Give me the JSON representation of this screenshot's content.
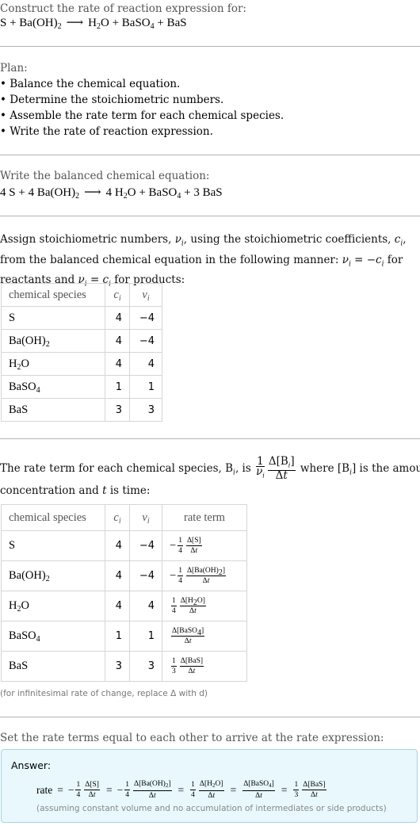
{
  "intro": {
    "label": "Construct the rate of reaction expression for:",
    "reaction": {
      "reactants": [
        "S",
        "Ba(OH)2"
      ],
      "products": [
        "H2O",
        "BaSO4",
        "BaS"
      ]
    }
  },
  "plan": {
    "label": "Plan:",
    "steps": [
      "Balance the chemical equation.",
      "Determine the stoichiometric numbers.",
      "Assemble the rate term for each chemical species.",
      "Write the rate of reaction expression."
    ]
  },
  "balanced": {
    "label": "Write the balanced chemical equation:",
    "coefficients": {
      "S": "4",
      "Ba(OH)2": "4",
      "H2O": "4",
      "BaSO4": "",
      "BaS": "3"
    }
  },
  "stoich": {
    "text_part1": "Assign stoichiometric numbers, ",
    "text_part2": ", using the stoichiometric coefficients, ",
    "text_part3": ", from the balanced chemical equation in the following manner: ",
    "text_part4": " for reactants and ",
    "text_part5": " for products:",
    "headers": [
      "chemical species",
      "c",
      "ν"
    ],
    "rows": [
      {
        "species": "S",
        "c": "4",
        "v": "−4"
      },
      {
        "species": "Ba(OH)2",
        "c": "4",
        "v": "−4"
      },
      {
        "species": "H2O",
        "c": "4",
        "v": "4"
      },
      {
        "species": "BaSO4",
        "c": "1",
        "v": "1"
      },
      {
        "species": "BaS",
        "c": "3",
        "v": "3"
      }
    ]
  },
  "rate_terms": {
    "text_part1": "The rate term for each chemical species, B",
    "text_part2": ", is",
    "text_part3": "where [B",
    "text_part4": "] is the amount concentration and ",
    "text_part5": " is time:",
    "headers": [
      "chemical species",
      "c",
      "ν",
      "rate term"
    ],
    "rows": [
      {
        "species": "S",
        "c": "4",
        "v": "−4",
        "sign": "−",
        "coef": "4",
        "term": "S"
      },
      {
        "species": "Ba(OH)2",
        "c": "4",
        "v": "−4",
        "sign": "−",
        "coef": "4",
        "term": "Ba(OH)2"
      },
      {
        "species": "H2O",
        "c": "4",
        "v": "4",
        "sign": "",
        "coef": "4",
        "term": "H2O"
      },
      {
        "species": "BaSO4",
        "c": "1",
        "v": "1",
        "sign": "",
        "coef": "",
        "term": "BaSO4"
      },
      {
        "species": "BaS",
        "c": "3",
        "v": "3",
        "sign": "",
        "coef": "3",
        "term": "BaS"
      }
    ],
    "note": "(for infinitesimal rate of change, replace Δ with d)"
  },
  "final": {
    "label": "Set the rate terms equal to each other to arrive at the rate expression:",
    "answer_label": "Answer:",
    "rate_word": "rate",
    "note": "(assuming constant volume and no accumulation of intermediates or side products)"
  }
}
